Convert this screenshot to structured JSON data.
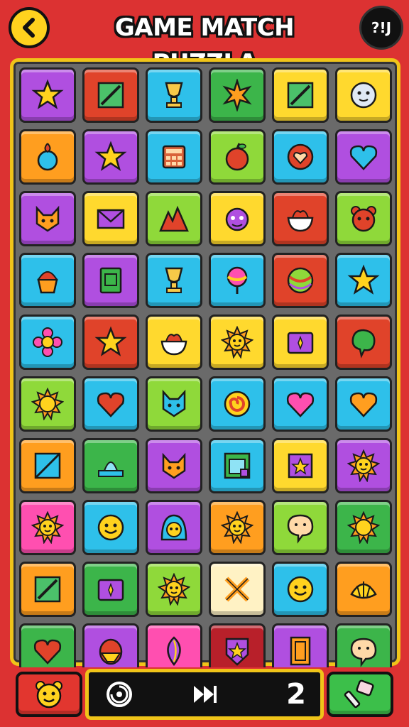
{
  "header": {
    "title": "GAME MATCH PUZZLA",
    "back_icon": "chevron-left-icon",
    "badge_text": "?!J"
  },
  "colors": {
    "background": "#dc3232",
    "board_border": "#f0c419",
    "board_fill": "#6a6a6a",
    "purple": "#b04fe0",
    "red": "#e0432a",
    "cyan": "#2ec0ea",
    "green": "#3cb54a",
    "yellow": "#ffd92e",
    "orange": "#ff9e1f",
    "pink": "#ff4fb0",
    "lime": "#8fd93a",
    "darkred": "#b8202a",
    "cream": "#fff2c4"
  },
  "board": {
    "rows": 10,
    "cols": 6,
    "tiles": [
      [
        "purple",
        "star"
      ],
      [
        "red",
        "pencil"
      ],
      [
        "cyan",
        "trophy"
      ],
      [
        "green",
        "starburst"
      ],
      [
        "yellow",
        "pencil"
      ],
      [
        "yellow",
        "clock-face"
      ],
      [
        "orange",
        "potion"
      ],
      [
        "purple",
        "star"
      ],
      [
        "cyan",
        "calculator"
      ],
      [
        "lime",
        "apple"
      ],
      [
        "cyan",
        "heart-face"
      ],
      [
        "purple",
        "heart"
      ],
      [
        "purple",
        "fox-face"
      ],
      [
        "yellow",
        "envelope"
      ],
      [
        "lime",
        "mountain"
      ],
      [
        "yellow",
        "creature"
      ],
      [
        "red",
        "bowl"
      ],
      [
        "lime",
        "bear-face"
      ],
      [
        "cyan",
        "cupcake"
      ],
      [
        "purple",
        "book"
      ],
      [
        "cyan",
        "trophy"
      ],
      [
        "cyan",
        "lollipop"
      ],
      [
        "red",
        "ball"
      ],
      [
        "cyan",
        "star"
      ],
      [
        "cyan",
        "flower"
      ],
      [
        "red",
        "star"
      ],
      [
        "yellow",
        "bowl"
      ],
      [
        "yellow",
        "sun-face"
      ],
      [
        "yellow",
        "card"
      ],
      [
        "red",
        "blob"
      ],
      [
        "lime",
        "sun"
      ],
      [
        "cyan",
        "heart"
      ],
      [
        "lime",
        "cat-face"
      ],
      [
        "cyan",
        "swirl"
      ],
      [
        "cyan",
        "heart"
      ],
      [
        "cyan",
        "heart"
      ],
      [
        "orange",
        "frame"
      ],
      [
        "green",
        "fountain"
      ],
      [
        "purple",
        "fox-face"
      ],
      [
        "cyan",
        "window"
      ],
      [
        "yellow",
        "star-card"
      ],
      [
        "purple",
        "sun-face"
      ],
      [
        "pink",
        "sun-face"
      ],
      [
        "cyan",
        "smile"
      ],
      [
        "purple",
        "hooded-face"
      ],
      [
        "orange",
        "sun-face"
      ],
      [
        "lime",
        "speech-face"
      ],
      [
        "green",
        "sun"
      ],
      [
        "orange",
        "pencil"
      ],
      [
        "green",
        "card"
      ],
      [
        "lime",
        "sun-face"
      ],
      [
        "cream",
        "cross"
      ],
      [
        "cyan",
        "smile"
      ],
      [
        "orange",
        "shell"
      ],
      [
        "green",
        "heart"
      ],
      [
        "purple",
        "egg-face"
      ],
      [
        "pink",
        "leaf"
      ],
      [
        "darkred",
        "shield"
      ],
      [
        "purple",
        "door"
      ],
      [
        "green",
        "speech-face"
      ]
    ]
  },
  "bottom_bar": {
    "left_powerup_icon": "bear-face-icon",
    "spin_icon": "spin-icon",
    "skip_icon": "fast-forward-icon",
    "move_count": "2",
    "right_powerup_icon": "hammer-icon"
  }
}
